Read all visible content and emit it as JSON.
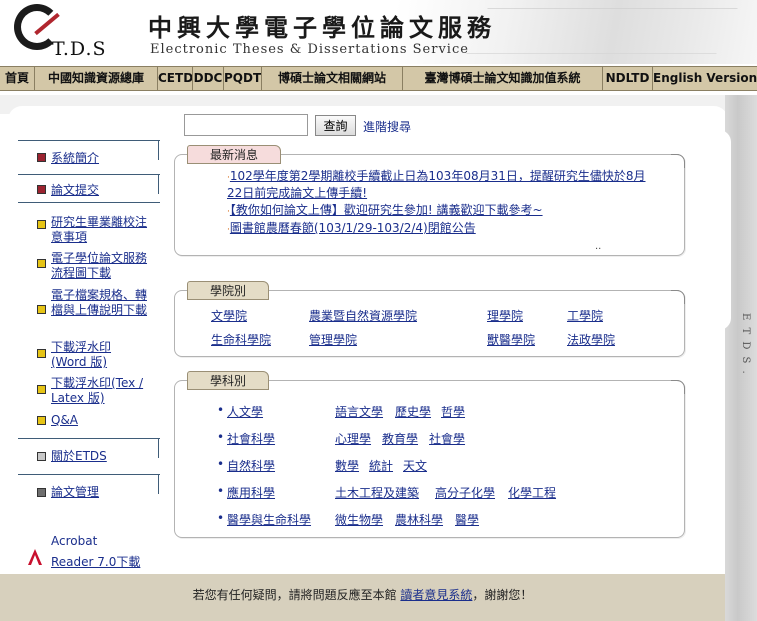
{
  "header": {
    "logo_text": "T.D.S",
    "title": "中興大學電子學位論文服務",
    "subtitle": "Electronic Theses & Dissertations Service"
  },
  "nav": [
    "首頁",
    "中國知識資源總庫",
    "CETD",
    "DDC",
    "PQDT",
    "博碩士論文相關網站",
    "臺灣博碩士論文知識加值系統",
    "NDLTD",
    "English Version"
  ],
  "search": {
    "input_value": "",
    "button_label": "查詢",
    "advanced_label": "進階搜尋"
  },
  "sidebar": {
    "items": [
      {
        "label": "系統簡介",
        "color": "red"
      },
      {
        "label": "論文提交",
        "color": "red"
      },
      {
        "label": "研究生畢業離校注意事項",
        "color": "yellow"
      },
      {
        "label": "電子學位論文服務流程圖下載",
        "color": "yellow"
      },
      {
        "label": "電子檔案規格、轉檔與上傳說明下載",
        "color": "yellow"
      },
      {
        "label": "下載浮水印(Word 版)",
        "color": "yellow"
      },
      {
        "label": "下載浮水印(Tex / Latex 版)",
        "color": "yellow"
      },
      {
        "label": "Q&A",
        "color": "yellow"
      },
      {
        "label": "關於ETDS",
        "color": "gray"
      },
      {
        "label": "論文管理",
        "color": "dark"
      }
    ],
    "acrobat_line1": "Acrobat",
    "acrobat_line2": "Reader 7.0下載"
  },
  "news": {
    "title": "最新消息",
    "items": [
      "102學年度第2學期離校手續截止日為103年08月31日，提醒研究生儘快於8月22日前完成論文上傳手續!",
      "【教你如何論文上傳】歡迎研究生參加! 講義歡迎下載參考~",
      "圖書館農曆春節(103/1/29-103/2/4)閉館公告"
    ],
    "more": ".."
  },
  "colleges": {
    "title": "學院別",
    "items": [
      "文學院",
      "農業暨自然資源學院",
      "理學院",
      "工學院",
      "生命科學院",
      "管理學院",
      "獸醫學院",
      "法政學院"
    ]
  },
  "subjects": {
    "title": "學科別",
    "groups": [
      {
        "name": "人文學",
        "subs": [
          "語言文學",
          "歷史學",
          "哲學"
        ]
      },
      {
        "name": "社會科學",
        "subs": [
          "心理學",
          "教育學",
          "社會學"
        ]
      },
      {
        "name": "自然科學",
        "subs": [
          "數學",
          "統計",
          "天文"
        ]
      },
      {
        "name": "應用科學",
        "subs": [
          "土木工程及建築",
          "高分子化學",
          "化學工程"
        ]
      },
      {
        "name": "醫學與生命科學",
        "subs": [
          "微生物學",
          "農林科學",
          "醫學"
        ]
      }
    ]
  },
  "side_label": "E T D S .",
  "footer": {
    "prefix": "若您有任何疑問，請將問題反應至本館 ",
    "link": "讀者意見系統",
    "suffix": "，謝謝您！"
  }
}
